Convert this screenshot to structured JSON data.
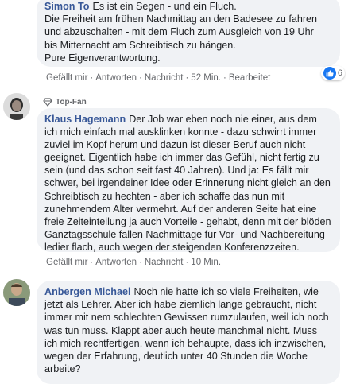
{
  "comments": [
    {
      "author": "Simon To",
      "text_lines": [
        "Es ist ein Segen - und ein Fluch.",
        "Die Freiheit am frühen Nachmittag an den Badesee zu fahren",
        "und abzuschalten - mit dem Fluch zum Ausgleich von 19 Uhr",
        "bis Mitternacht am Schreibtisch zu hängen.",
        "Pure Eigenverantwortung."
      ],
      "actions": {
        "like": "Gefällt mir",
        "reply": "Antworten",
        "message": "Nachricht",
        "time": "52 Min.",
        "edited": "Bearbeitet"
      },
      "reactions": {
        "icon": "like-icon",
        "count": "6"
      }
    },
    {
      "badge": "Top-Fan",
      "author": "Klaus Hagemann",
      "text": "Der Job war eben noch nie einer, aus dem ich mich einfach mal ausklinken konnte - dazu schwirrt immer zuviel im Kopf herum und dazun ist dieser Beruf auch nicht geeignet. Eigentlich habe ich immer das Gefühl, nicht fertig zu sein (und das schon seit fast 40 Jahren). Und ja: Es fällt mir schwer, bei irgendeiner Idee oder Erinnerung nicht gleich an den Schreibtisch zu hechten - aber ich schaffe das nun mit zunehmendem Alter vermehrt. Auf der anderen Seite hat eine freie Zeiteinteilung ja auch Vorteile - gehabt, denn mit der blöden Ganztagsschule fallen Nachmittage für Vor- und Nachbereitung ledier flach, auch wegen der steigenden Konferenzzeiten.",
      "actions": {
        "like": "Gefällt mir",
        "reply": "Antworten",
        "message": "Nachricht",
        "time": "10 Min."
      }
    },
    {
      "author": "Anbergen Michael",
      "text": "Noch nie hatte ich so viele Freiheiten, wie jetzt als Lehrer. Aber ich habe ziemlich lange gebraucht, nicht immer mit nem schlechten Gewissen rumzulaufen, weil ich noch was tun muss. Klappt aber auch heute manchmal nicht. Muss ich mich rechtfertigen, wenn ich behaupte, dass ich inzwischen, wegen der Erfahrung, deutlich unter 40 Stunden die Woche arbeite?"
    }
  ],
  "colors": {
    "author": "#385898",
    "bubble": "#f0f2f5",
    "meta": "#65676b",
    "like": "#1877f2"
  }
}
